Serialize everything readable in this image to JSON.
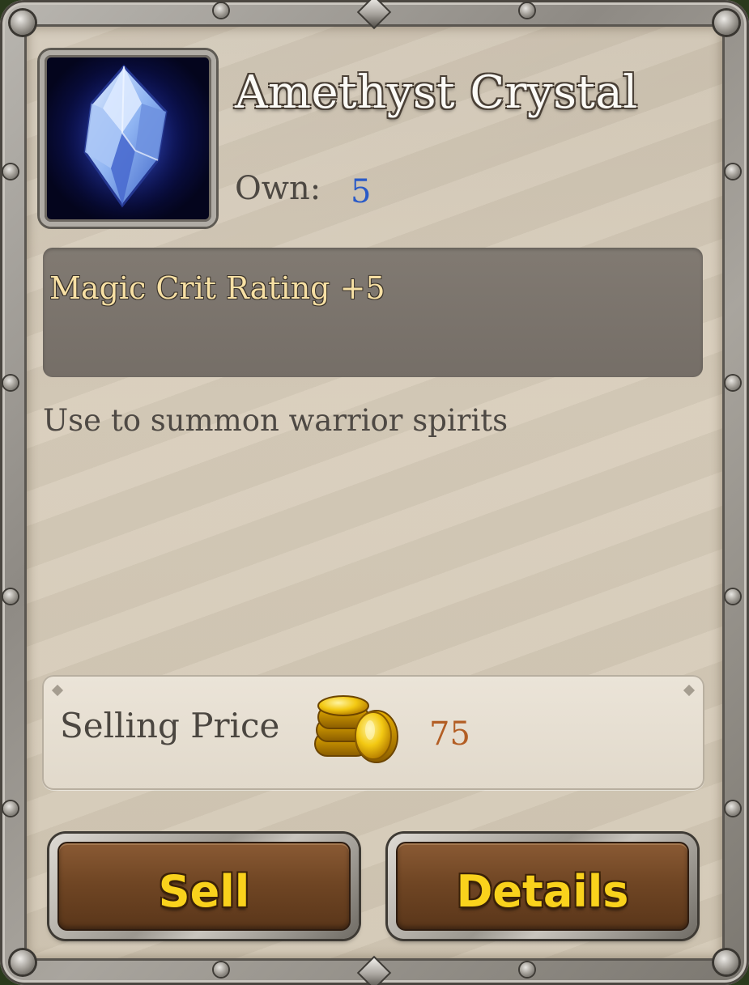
{
  "item": {
    "name": "Amethyst Crystal",
    "icon": "crystal-gem-icon",
    "own_label": "Own:",
    "own_count": "5",
    "stat": "Magic Crit Rating +5",
    "description": "Use to summon warrior spirits"
  },
  "price": {
    "label": "Selling Price",
    "icon": "gold-coins-icon",
    "value": "75"
  },
  "actions": {
    "sell_label": "Sell",
    "details_label": "Details"
  },
  "colors": {
    "title": "#fbfaf6",
    "own_count": "#2a5ac7",
    "stat_text": "#f7e0a4",
    "price_value": "#b35e24",
    "button_text": "#f9d21c",
    "button_face": "#704624",
    "parchment": "#d8cdbb"
  }
}
